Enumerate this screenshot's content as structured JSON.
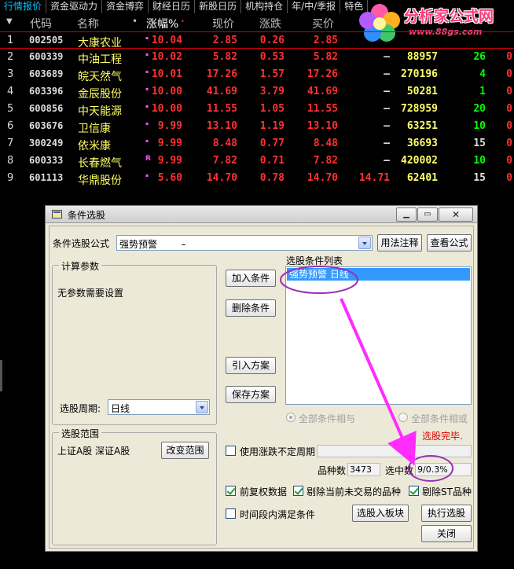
{
  "tabs": [
    "行情报价",
    "资金驱动力",
    "资金博弈",
    "财经日历",
    "新股日历",
    "机构持仓",
    "年/中/季报",
    "特色"
  ],
  "logo": {
    "title": "分析家公式网",
    "url": "www.88gs.com"
  },
  "header": {
    "code": "代码",
    "name": "名称",
    "dot": "•",
    "chg": "涨幅%",
    "price": "现价",
    "diff": "涨跌",
    "buy": "买价"
  },
  "stocks": [
    {
      "idx": "1",
      "code": "002505",
      "name": "大康农业",
      "flag": "",
      "chg": "10.04",
      "price": "2.85",
      "diff": "0.26",
      "buy": "2.85",
      "sell": "",
      "vol": "",
      "cur": "",
      "last": ""
    },
    {
      "idx": "2",
      "code": "600339",
      "name": "中油工程",
      "flag": "",
      "chg": "10.02",
      "price": "5.82",
      "diff": "0.53",
      "buy": "5.82",
      "sell": "—",
      "vol": "88957",
      "cur": "26",
      "last": "0"
    },
    {
      "idx": "3",
      "code": "603689",
      "name": "皖天然气",
      "flag": "",
      "chg": "10.01",
      "price": "17.26",
      "diff": "1.57",
      "buy": "17.26",
      "sell": "—",
      "vol": "270196",
      "cur": "4",
      "last": "0"
    },
    {
      "idx": "4",
      "code": "603396",
      "name": "金辰股份",
      "flag": "",
      "chg": "10.00",
      "price": "41.69",
      "diff": "3.79",
      "buy": "41.69",
      "sell": "—",
      "vol": "50281",
      "cur": "1",
      "last": "0"
    },
    {
      "idx": "5",
      "code": "600856",
      "name": "中天能源",
      "flag": "",
      "chg": "10.00",
      "price": "11.55",
      "diff": "1.05",
      "buy": "11.55",
      "sell": "—",
      "vol": "728959",
      "cur": "20",
      "last": "0"
    },
    {
      "idx": "6",
      "code": "603676",
      "name": "卫信康",
      "flag": "",
      "chg": "9.99",
      "price": "13.10",
      "diff": "1.19",
      "buy": "13.10",
      "sell": "—",
      "vol": "63251",
      "cur": "10",
      "last": "0"
    },
    {
      "idx": "7",
      "code": "300249",
      "name": "依米康",
      "flag": "",
      "chg": "9.99",
      "price": "8.48",
      "diff": "0.77",
      "buy": "8.48",
      "sell": "—",
      "vol": "36693",
      "cur": "15",
      "last": "0"
    },
    {
      "idx": "8",
      "code": "600333",
      "name": "长春燃气",
      "flag": "R",
      "chg": "9.99",
      "price": "7.82",
      "diff": "0.71",
      "buy": "7.82",
      "sell": "—",
      "vol": "420002",
      "cur": "10",
      "last": "0"
    },
    {
      "idx": "9",
      "code": "601113",
      "name": "华鼎股份",
      "flag": "",
      "chg": "5.60",
      "price": "14.70",
      "diff": "0.78",
      "buy": "14.70",
      "sell": "14.71",
      "vol": "62401",
      "cur": "15",
      "last": "0"
    }
  ],
  "colors": {
    "up": "#ff3030",
    "green": "#00ff00",
    "white": "#dddddd",
    "yellow": "#ffff66"
  },
  "dialog": {
    "title": "条件选股",
    "formula_label": "条件选股公式",
    "formula_value": "强势预警        –",
    "usage_button": "用法注释",
    "view_button": "查看公式",
    "params_title": "计算参数",
    "params_text": "无参数需要设置",
    "period_label": "选股周期:",
    "period_value": "日线",
    "range_title": "选股范围",
    "range_text": "上证A股  深证A股",
    "range_button": "改变范围",
    "add_button": "加入条件",
    "delete_button": "删除条件",
    "import_button": "引入方案",
    "save_button": "保存方案",
    "list_title": "选股条件列表",
    "list_item": "强势预警   日线",
    "radio_and": "全部条件相与",
    "radio_or": "全部条件相或",
    "status": "选股完毕.",
    "use_variable_period": "使用涨跌不定周期",
    "count_label": "品种数",
    "count_value": "3473",
    "selected_label": "选中数",
    "selected_value": "9/0.3%",
    "pre_adjust": "前复权数据",
    "exclude_untraded": "剔除当前未交易的品种",
    "exclude_st": "剔除ST品种",
    "time_range": "时间段内满足条件",
    "to_block_button": "选股入板块",
    "execute_button": "执行选股",
    "close_button": "关闭"
  }
}
